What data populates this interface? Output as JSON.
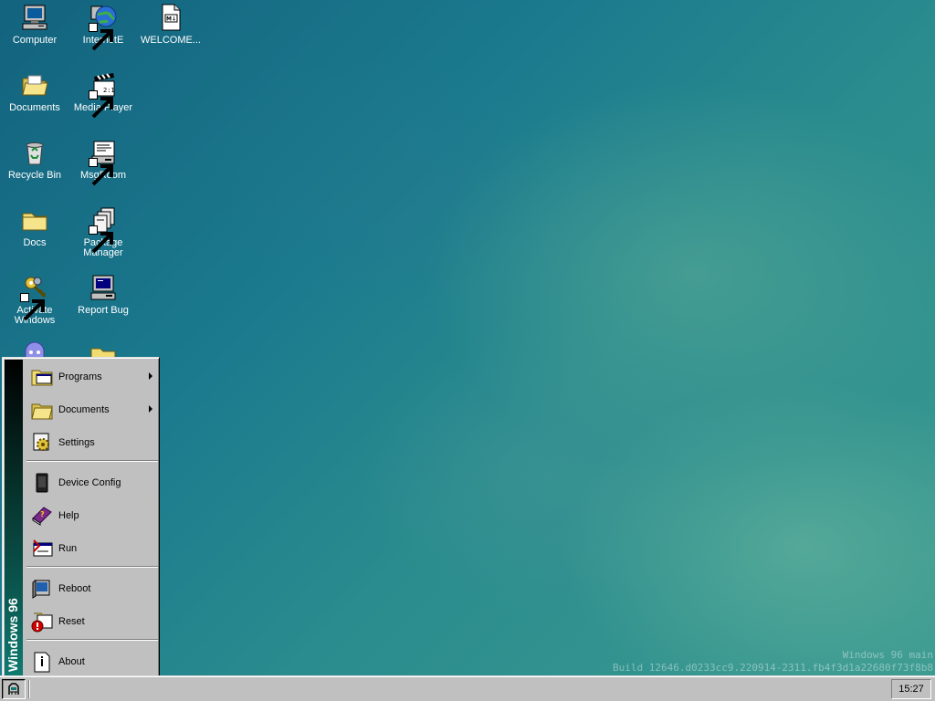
{
  "desktop": {
    "icons": [
      {
        "label": "Computer",
        "icon": "computer-icon"
      },
      {
        "label": "InternetE",
        "icon": "internet-explorer-icon"
      },
      {
        "label": "WELCOME...",
        "icon": "markdown-file-icon"
      },
      {
        "label": "Documents",
        "icon": "open-folder-icon"
      },
      {
        "label": "Media Player",
        "icon": "media-player-icon"
      },
      {
        "label": "Recycle Bin",
        "icon": "recycle-bin-icon"
      },
      {
        "label": "MsgRoom",
        "icon": "msgroom-icon"
      },
      {
        "label": "Docs",
        "icon": "folder-icon"
      },
      {
        "label": "Package Manager",
        "icon": "package-manager-icon"
      },
      {
        "label": "Activate Windows",
        "icon": "keys-icon"
      },
      {
        "label": "Report Bug",
        "icon": "report-bug-icon"
      }
    ],
    "build": {
      "line1": "Windows 96 main",
      "line2": "Build 12646.d0233cc9.220914-2311.fb4f3d1a22680f73f8b8"
    }
  },
  "start_menu": {
    "banner": "Windows 96",
    "items": [
      {
        "label": "Programs",
        "icon": "programs-icon",
        "submenu": true
      },
      {
        "label": "Documents",
        "icon": "documents-folder-icon",
        "submenu": true
      },
      {
        "label": "Settings",
        "icon": "settings-icon",
        "submenu": false
      },
      {
        "label": "Device Config",
        "icon": "device-config-icon",
        "submenu": false
      },
      {
        "label": "Help",
        "icon": "help-book-icon",
        "submenu": false
      },
      {
        "label": "Run",
        "icon": "run-icon",
        "submenu": false
      },
      {
        "label": "Reboot",
        "icon": "reboot-icon",
        "submenu": false
      },
      {
        "label": "Reset",
        "icon": "reset-icon",
        "submenu": false
      },
      {
        "label": "About",
        "icon": "about-icon",
        "submenu": false
      }
    ]
  },
  "taskbar": {
    "clock": "15:27",
    "start_icon": "start-logo-icon"
  },
  "colors": {
    "desktop_bg": "#1b7a8e",
    "chrome": "#c0c0c0",
    "banner_bottom": "#0e7a70"
  }
}
